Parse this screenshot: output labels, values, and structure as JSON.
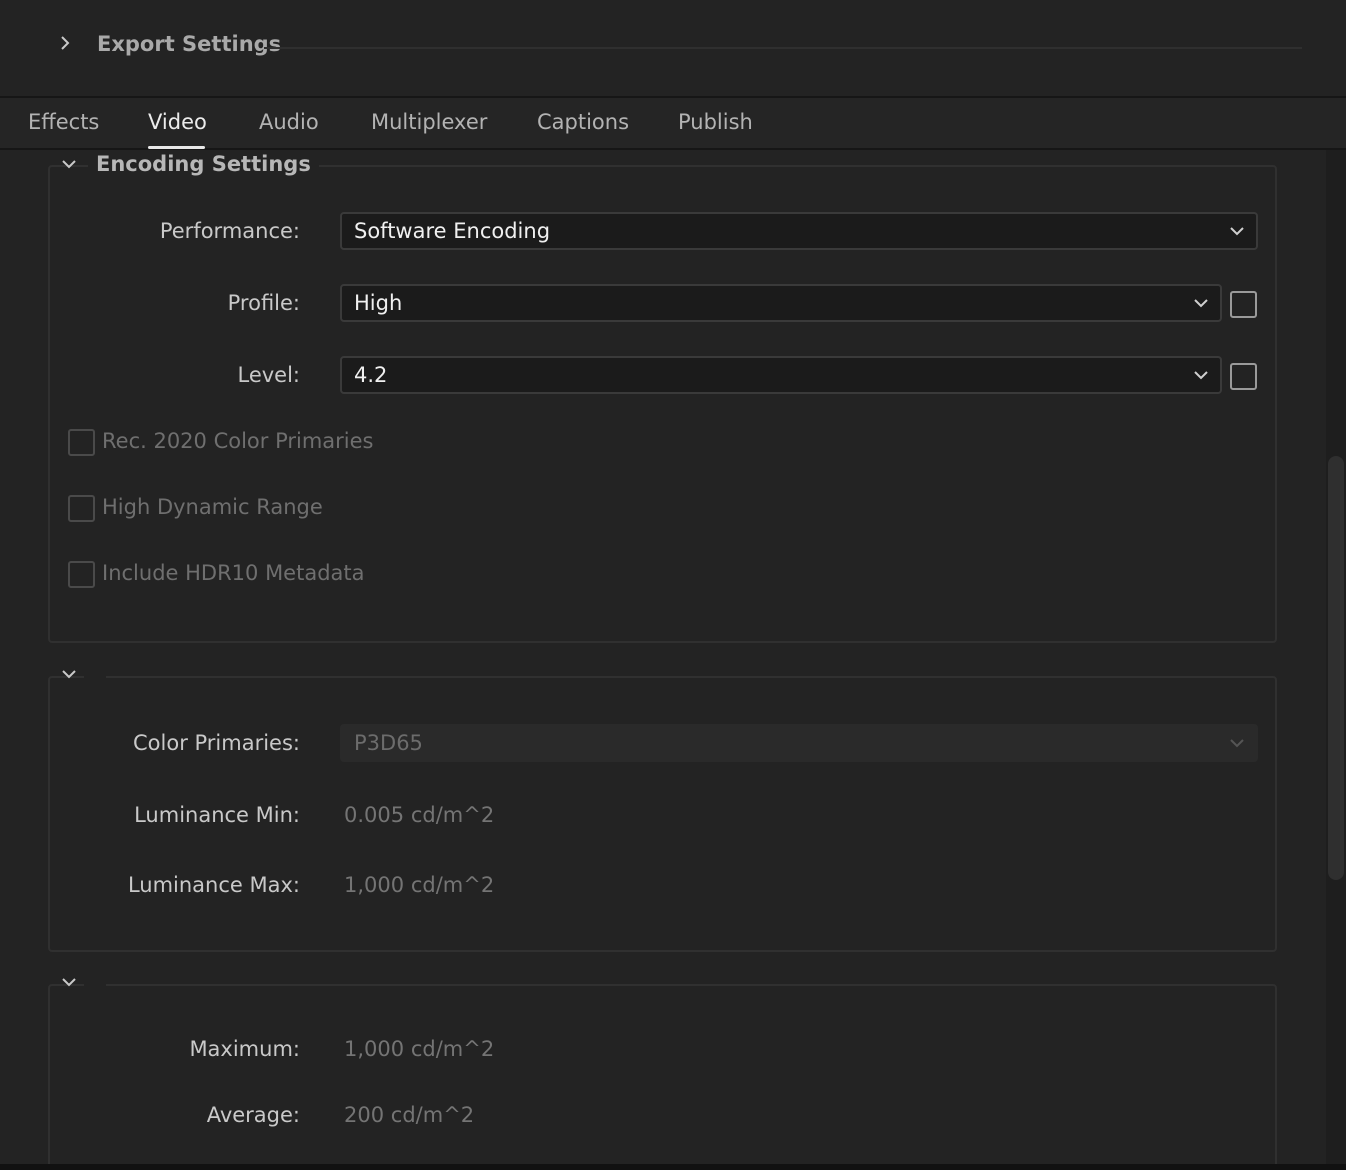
{
  "export": {
    "title": "Export Settings"
  },
  "tabs": {
    "effects": "Effects",
    "video": "Video",
    "audio": "Audio",
    "multiplexer": "Multiplexer",
    "captions": "Captions",
    "publish": "Publish",
    "active": "Video"
  },
  "encoding": {
    "title": "Encoding Settings",
    "performance": {
      "label": "Performance:",
      "value": "Software Encoding"
    },
    "profile": {
      "label": "Profile:",
      "value": "High"
    },
    "level": {
      "label": "Level:",
      "value": "4.2"
    },
    "rec2020": "Rec. 2020 Color Primaries",
    "hdr": "High Dynamic Range",
    "hdr10": "Include HDR10 Metadata"
  },
  "mastering": {
    "color_primaries": {
      "label": "Color Primaries:",
      "value": "P3D65"
    },
    "lum_min": {
      "label": "Luminance Min:",
      "value": "0.005",
      "unit": "cd/m^2"
    },
    "lum_max": {
      "label": "Luminance Max:",
      "value": "1,000",
      "unit": "cd/m^2"
    }
  },
  "content_light": {
    "maximum": {
      "label": "Maximum:",
      "value": "1,000",
      "unit": "cd/m^2"
    },
    "average": {
      "label": "Average:",
      "value": "200",
      "unit": "cd/m^2"
    }
  },
  "colors": {
    "background": "#232323",
    "tab_active": "#e8e8e8",
    "border": "#303030"
  }
}
